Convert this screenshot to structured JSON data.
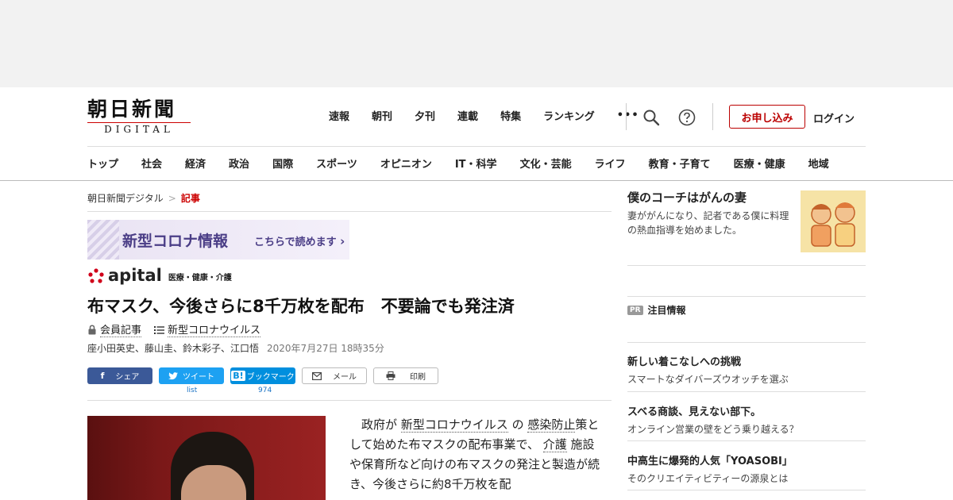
{
  "header": {
    "logo_main": "朝日新聞",
    "logo_sub": "DIGITAL",
    "top_nav": [
      "速報",
      "朝刊",
      "夕刊",
      "連載",
      "特集",
      "ランキング"
    ],
    "more": "•••",
    "signup_label": "お申し込み",
    "login_label": "ログイン"
  },
  "category_nav": [
    "トップ",
    "社会",
    "経済",
    "政治",
    "国際",
    "スポーツ",
    "オピニオン",
    "IT・科学",
    "文化・芸能",
    "ライフ",
    "教育・子育て",
    "医療・健康",
    "地域"
  ],
  "breadcrumb": {
    "home": "朝日新聞デジタル",
    "current": "記事",
    "sep": ">"
  },
  "banner": {
    "title": "新型コロナ情報",
    "link": "こちらで読めます"
  },
  "apital": {
    "logo": "apital",
    "sub": "医療・健康・介護"
  },
  "article": {
    "headline": "布マスク、今後さらに8千万枚を配布　不要論でも発注済",
    "member_tag": "会員記事",
    "topic_tag": "新型コロナウイルス",
    "authors": "座小田英史、藤山圭、鈴木彩子、江口悟",
    "date": "2020年7月27日 18時35分",
    "body": {
      "p1": "政府が",
      "link1": "新型コロナウイルス",
      "p2": "の",
      "link2": "感染防止",
      "p3": "策として始めた布マスクの配布事業で、",
      "link3": "介護",
      "p4": "施設や保育所など向けの布マスクの発注と製造が続き、今後さらに約8千万枚を配"
    }
  },
  "share": {
    "facebook": "シェア",
    "twitter": "ツイート",
    "hatena": "ブックマーク",
    "hatena_icon": "B!",
    "mail": "メール",
    "print": "印刷",
    "twitter_count": "list",
    "hatena_count": "974"
  },
  "sidebar": {
    "feature": {
      "title": "僕のコーチはがんの妻",
      "desc": "妻ががんになり、記者である僕に料理の熱血指導を始めました。"
    },
    "pr_badge": "PR",
    "pr_label": "注目情報",
    "items": [
      {
        "title": "新しい着こなしへの挑戦",
        "desc": "スマートなダイバーズウオッチを選ぶ"
      },
      {
        "title": "スベる商談、見えない部下。",
        "desc": "オンライン営業の壁をどう乗り越える？"
      },
      {
        "title": "中高生に爆発的人気「YOASOBI」",
        "desc": "そのクリエイティビティーの源泉とは"
      }
    ]
  },
  "colors": {
    "accent_red": "#bb0000",
    "facebook": "#3b5998",
    "twitter": "#1da1f2",
    "hatena": "#008fde",
    "banner_purple": "#4a3d86"
  }
}
